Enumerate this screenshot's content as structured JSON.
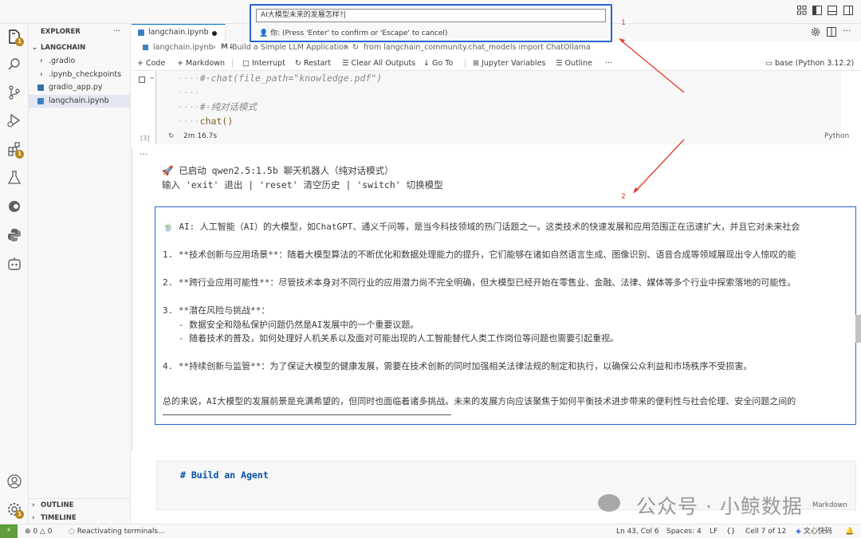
{
  "titlebar": {
    "icons": [
      "layout-icon",
      "toggle-sidebar-icon",
      "toggle-panel-icon",
      "toggle-secondary-icon"
    ]
  },
  "quickpick": {
    "value": "AI大模型未来的发展怎样?",
    "message": "你: (Press 'Enter' to confirm or 'Escape' to cancel)"
  },
  "callouts": {
    "one": "1",
    "two": "2"
  },
  "activity": {
    "explorer_badge": "1",
    "extensions_badge": "1",
    "settings_badge": "1"
  },
  "sidebar": {
    "title": "EXPLORER",
    "more": "···",
    "folder": "LANGCHAIN",
    "items": [
      {
        "label": ".gradio"
      },
      {
        "label": ".ipynb_checkpoints"
      },
      {
        "label": "gradio_app.py"
      },
      {
        "label": "langchain.ipynb"
      }
    ],
    "outline": "OUTLINE",
    "timeline": "TIMELINE"
  },
  "tab": {
    "label": "langchain.ipynb"
  },
  "breadcrumb": {
    "file": "langchain.ipynb",
    "section": "Build a Simple LLM Application",
    "symbol": "from langchain_community.chat_models import ChatOllama"
  },
  "toolbar": {
    "code": "Code",
    "markdown": "Markdown",
    "interrupt": "Interrupt",
    "restart": "Restart",
    "clear_all": "Clear All Outputs",
    "goto": "Go To",
    "variables": "Jupyter Variables",
    "outline": "Outline",
    "more": "···",
    "kernel": "base (Python 3.12.2)"
  },
  "cell": {
    "lines": [
      {
        "indent": "····",
        "text": "#·chat(file_path=\"knowledge.pdf\")",
        "kind": "comment"
      },
      {
        "indent": "····",
        "text": "",
        "kind": "blank"
      },
      {
        "indent": "····",
        "text": "#·纯对话模式",
        "kind": "comment"
      },
      {
        "indent": "····",
        "text": "chat()",
        "kind": "code"
      }
    ],
    "exec_count": "[3]",
    "duration": "2m 16.7s",
    "language": "Python"
  },
  "output": {
    "ellipsis": "···",
    "line1": "🚀 已启动 qwen2.5:1.5b 聊天机器人（纯对话模式）",
    "line2": "输入 'exit' 退出 | 'reset' 清空历史 | 'switch' 切换模型",
    "answer": [
      "🍵 AI: 人工智能（AI）的大模型，如ChatGPT、通义千问等，是当今科技领域的热门话题之一。这类技术的快速发展和应用范围正在迅速扩大，并且它对未来社会",
      "",
      "1. **技术创新与应用场景**：随着大模型算法的不断优化和数据处理能力的提升，它们能够在诸如自然语言生成、图像识别、语音合成等领域展现出令人惊叹的能",
      "",
      "2. **跨行业应用可能性**：尽管技术本身对不同行业的应用潜力尚不完全明确，但大模型已经开始在零售业、金融、法律、媒体等多个行业中探索落地的可能性。",
      "",
      "3. **潜在风险与挑战**：",
      "   - 数据安全和隐私保护问题仍然是AI发展中的一个重要议题。",
      "   - 随着技术的普及，如何处理好人机关系以及面对可能出现的人工智能替代人类工作岗位等问题也需要引起重视。",
      "",
      "4. **持续创新与监管**：为了保证大模型的健康发展，需要在技术创新的同时加强相关法律法规的制定和执行，以确保公众利益和市场秩序不受损害。",
      "",
      "总的来说，AI大模型的发展前景是充满希望的，但同时也面临着诸多挑战。未来的发展方向应该聚焦于如何平衡技术进步带来的便利性与社会伦理、安全问题之间的"
    ]
  },
  "markdown_cell": {
    "text": "# Build an Agent",
    "lang": "Markdown"
  },
  "watermark": "公众号 · 小鲸数据",
  "status": {
    "remote": "⚡",
    "problems": "0",
    "warnings": "0",
    "activity": "Reactivating terminals...",
    "position": "Ln 43, Col 6",
    "spaces": "Spaces: 4",
    "eol": "LF",
    "cell": "Cell 7 of 12",
    "extension": "文心快码"
  },
  "colors": {
    "accent": "#2b63d1",
    "callout": "#e03c2c",
    "badge": "#b6871d"
  }
}
